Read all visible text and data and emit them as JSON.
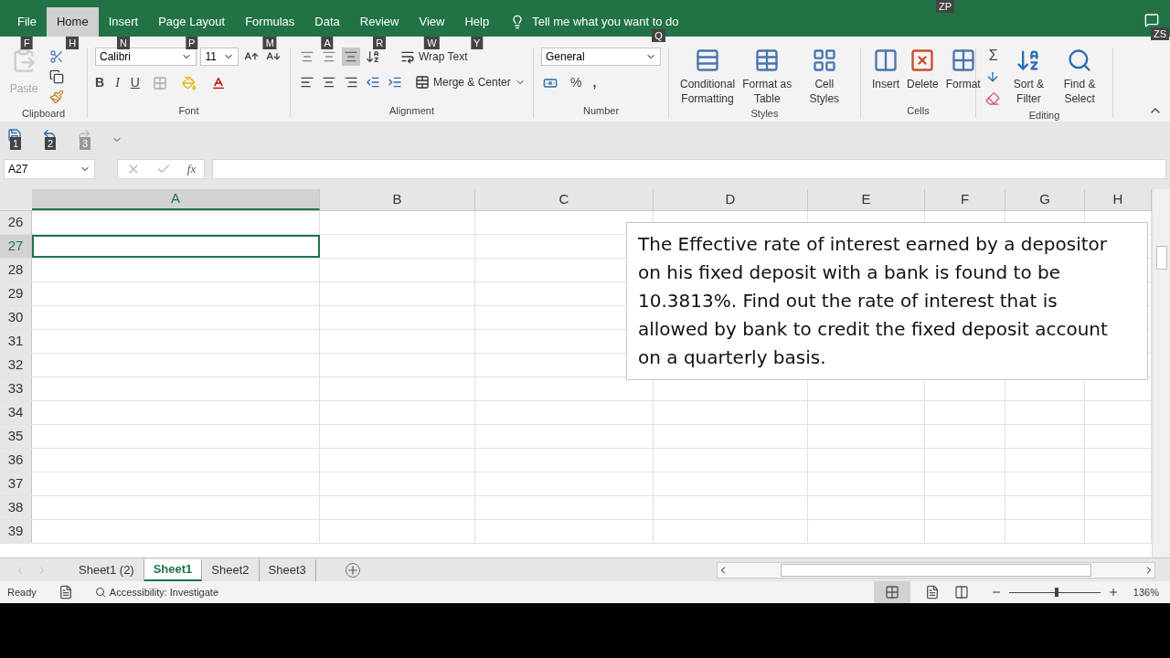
{
  "ribbon_tabs": [
    {
      "label": "File",
      "keytip": "F",
      "selected": false
    },
    {
      "label": "Home",
      "keytip": "H",
      "selected": true
    },
    {
      "label": "Insert",
      "keytip": "N",
      "selected": false
    },
    {
      "label": "Page Layout",
      "keytip": "P",
      "selected": false
    },
    {
      "label": "Formulas",
      "keytip": "M",
      "selected": false
    },
    {
      "label": "Data",
      "keytip": "A",
      "selected": false
    },
    {
      "label": "Review",
      "keytip": "R",
      "selected": false
    },
    {
      "label": "View",
      "keytip": "W",
      "selected": false
    },
    {
      "label": "Help",
      "keytip": "Y",
      "selected": false
    }
  ],
  "tell_me": {
    "placeholder": "Tell me what you want to do",
    "keytip": "Q"
  },
  "share_keytips": [
    "ZP",
    "ZS"
  ],
  "clipboard": {
    "paste": "Paste",
    "group": "Clipboard"
  },
  "font": {
    "name": "Calibri",
    "size": "11",
    "bold": "B",
    "italic": "I",
    "underline": "U",
    "group": "Font"
  },
  "alignment": {
    "wrap": "Wrap Text",
    "merge": "Merge & Center",
    "group": "Alignment"
  },
  "number": {
    "format": "General",
    "percent": "%",
    "comma": ",",
    "group": "Number"
  },
  "styles": {
    "items": [
      "Conditional Formatting",
      "Format as Table",
      "Cell Styles"
    ],
    "group": "Styles"
  },
  "cells": {
    "items": [
      "Insert",
      "Delete",
      "Format"
    ],
    "group": "Cells"
  },
  "editing": {
    "sigma": "Σ",
    "items": [
      "Sort & Filter",
      "Find & Select"
    ],
    "group": "Editing"
  },
  "quick_access": [
    "1",
    "2",
    "3"
  ],
  "name_box": "A27",
  "fx": "fx",
  "columns": [
    {
      "label": "A",
      "selected": true
    },
    {
      "label": "B",
      "selected": false
    },
    {
      "label": "C",
      "selected": false
    },
    {
      "label": "D",
      "selected": false
    },
    {
      "label": "E",
      "selected": false
    },
    {
      "label": "F",
      "selected": false
    },
    {
      "label": "G",
      "selected": false
    },
    {
      "label": "H",
      "selected": false
    }
  ],
  "rows": [
    {
      "label": "26",
      "selected": false
    },
    {
      "label": "27",
      "selected": true
    },
    {
      "label": "28",
      "selected": false
    },
    {
      "label": "29",
      "selected": false
    },
    {
      "label": "30",
      "selected": false
    },
    {
      "label": "31",
      "selected": false
    },
    {
      "label": "32",
      "selected": false
    },
    {
      "label": "33",
      "selected": false
    },
    {
      "label": "34",
      "selected": false
    },
    {
      "label": "35",
      "selected": false
    },
    {
      "label": "36",
      "selected": false
    },
    {
      "label": "37",
      "selected": false
    },
    {
      "label": "38",
      "selected": false
    },
    {
      "label": "39",
      "selected": false
    }
  ],
  "text_box": "The Effective rate of interest earned by a depositor on his fixed deposit with a bank is found to be 10.3813%. Find out the rate of interest that is allowed by bank to credit the fixed deposit account on a quarterly basis.",
  "sheet_tabs": [
    {
      "label": "Sheet1 (2)",
      "selected": false
    },
    {
      "label": "Sheet1",
      "selected": true
    },
    {
      "label": "Sheet2",
      "selected": false
    },
    {
      "label": "Sheet3",
      "selected": false
    }
  ],
  "status_bar": {
    "mode": "Ready",
    "accessibility": "Accessibility: Investigate",
    "zoom": "136%",
    "zoom_slider": {
      "level": 0.5
    }
  }
}
